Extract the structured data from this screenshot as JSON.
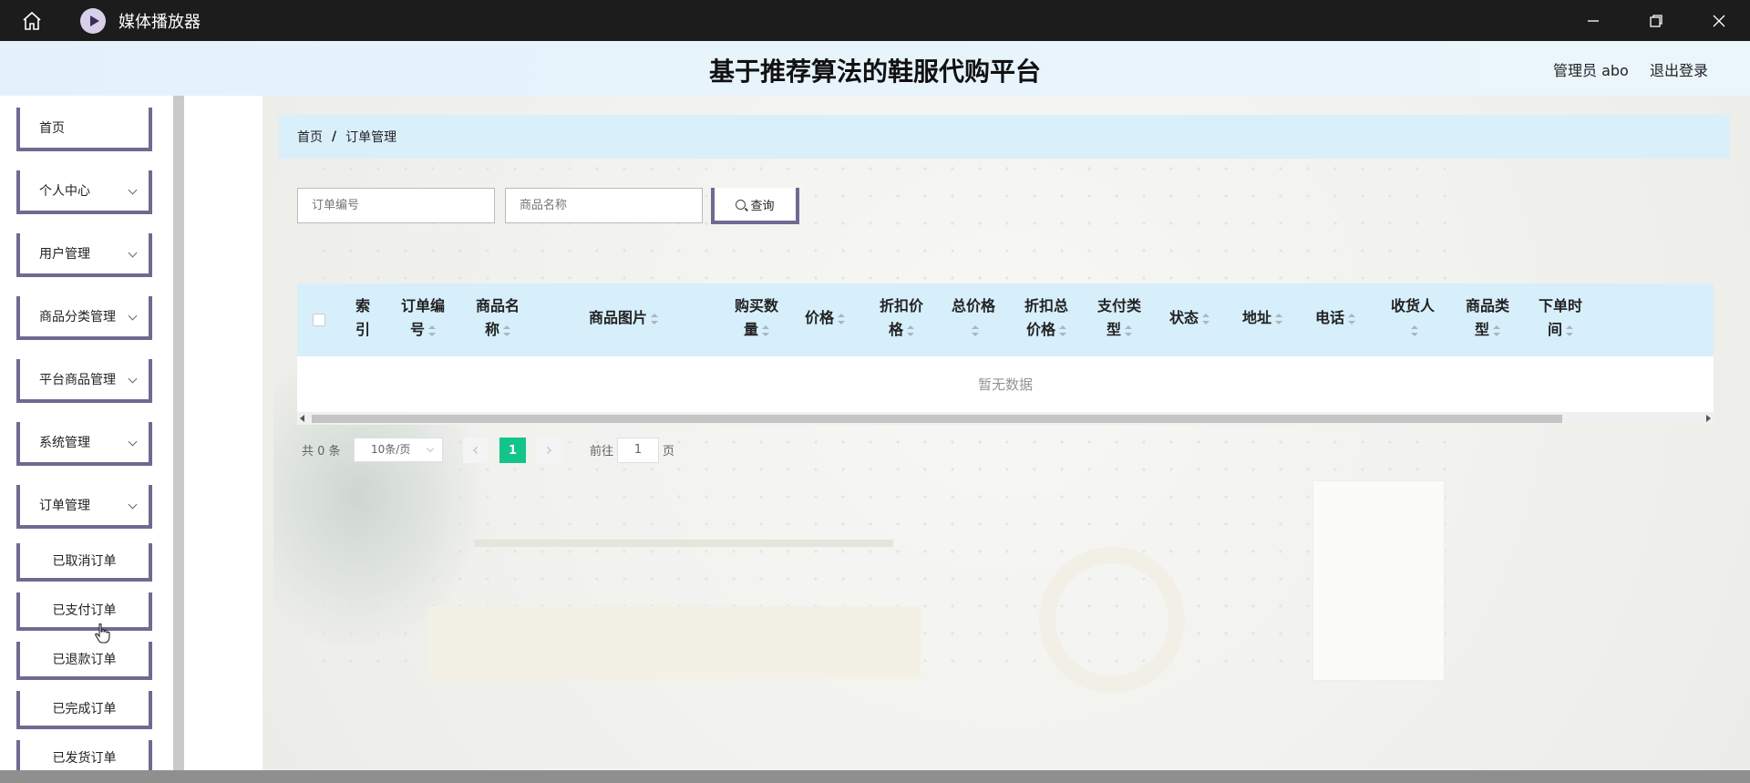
{
  "window": {
    "title": "媒体播放器",
    "icons": [
      "home-icon",
      "media-player-icon",
      "minimize-icon",
      "restore-icon",
      "close-icon"
    ]
  },
  "header": {
    "title": "基于推荐算法的鞋服代购平台",
    "admin": "管理员 abo",
    "logout": "退出登录"
  },
  "sidebar": {
    "items": [
      {
        "label": "首页",
        "expandable": false
      },
      {
        "label": "个人中心",
        "expandable": true
      },
      {
        "label": "用户管理",
        "expandable": true
      },
      {
        "label": "商品分类管理",
        "expandable": true
      },
      {
        "label": "平台商品管理",
        "expandable": true
      },
      {
        "label": "系统管理",
        "expandable": true
      },
      {
        "label": "订单管理",
        "expandable": true
      }
    ],
    "subitems": [
      "已取消订单",
      "已支付订单",
      "已退款订单",
      "已完成订单",
      "已发货订单"
    ]
  },
  "breadcrumb": {
    "home": "首页",
    "sep": "/",
    "current": "订单管理"
  },
  "search": {
    "order_no_placeholder": "订单编号",
    "product_name_placeholder": "商品名称",
    "button": "查询"
  },
  "table": {
    "columns": [
      {
        "l1": "索",
        "l2": "引",
        "sortable": false
      },
      {
        "l1": "订单编",
        "l2": "号",
        "sortable": true
      },
      {
        "l1": "商品名",
        "l2": "称",
        "sortable": true
      },
      {
        "l1": "商品图片",
        "l2": "",
        "sortable": true
      },
      {
        "l1": "购买数",
        "l2": "量",
        "sortable": true
      },
      {
        "l1": "价格",
        "l2": "",
        "sortable": true
      },
      {
        "l1": "折扣价",
        "l2": "格",
        "sortable": true
      },
      {
        "l1": "总价格",
        "l2": "",
        "sortable": true
      },
      {
        "l1": "折扣总",
        "l2": "价格",
        "sortable": true
      },
      {
        "l1": "支付类",
        "l2": "型",
        "sortable": true
      },
      {
        "l1": "状态",
        "l2": "",
        "sortable": true
      },
      {
        "l1": "地址",
        "l2": "",
        "sortable": true
      },
      {
        "l1": "电话",
        "l2": "",
        "sortable": true
      },
      {
        "l1": "收货人",
        "l2": "",
        "sortable": true
      },
      {
        "l1": "商品类",
        "l2": "型",
        "sortable": true
      },
      {
        "l1": "下单时",
        "l2": "间",
        "sortable": true
      }
    ],
    "empty_text": "暂无数据"
  },
  "pagination": {
    "total": "共 0 条",
    "page_size": "10条/页",
    "current_page": "1",
    "goto_label": "前往",
    "goto_value": "1",
    "page_suffix": "页"
  },
  "colors": {
    "accent": "#13c48b",
    "menu_border": "#6e6b91",
    "header_row": "#d6effb",
    "breadcrumb_bg": "#d9f0fb"
  }
}
